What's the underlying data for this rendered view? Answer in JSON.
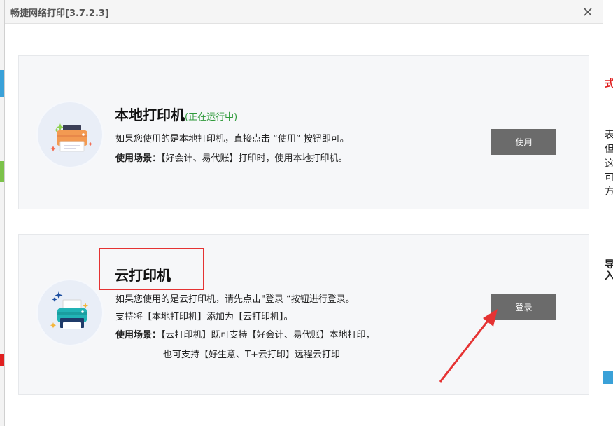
{
  "window": {
    "title": "畅捷网络打印[3.7.2.3]"
  },
  "local_printer": {
    "heading": "本地打印机",
    "status": "(正在运行中)",
    "desc": "如果您使用的是本地打印机，直接点击 “使用” 按钮即可。",
    "scene_label": "使用场景：",
    "scene_text": "【好会计、易代账】打印时，使用本地打印机。",
    "button_label": "使用"
  },
  "cloud_printer": {
    "heading": "云打印机",
    "desc": "如果您使用的是云打印机，请先点击\"登录 “按钮进行登录。",
    "support": "支持将【本地打印机】添加为【云打印机】。",
    "scene_label": "使用场景：",
    "scene_text": "【云打印机】既可支持【好会计、易代账】本地打印，",
    "scene_text2": "也可支持【好生意、T+云打印】远程云打印",
    "button_label": "登录"
  },
  "background_right": [
    "式",
    "表",
    "但",
    "这",
    "可",
    "方",
    "导入"
  ],
  "colors": {
    "button": "#6b6b6b",
    "status": "#2e9a3a",
    "annotation": "#e53333",
    "panel": "#f6f7f9"
  },
  "icons": [
    "close-icon",
    "local-printer-icon",
    "cloud-printer-icon"
  ]
}
